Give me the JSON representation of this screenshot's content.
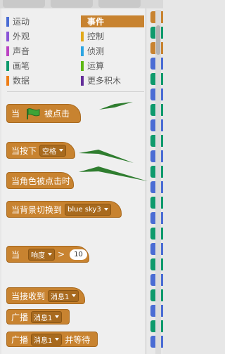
{
  "categories": [
    {
      "label": "运动",
      "color": "#4a6cd4",
      "selected": false
    },
    {
      "label": "事件",
      "color": "#c88330",
      "selected": true
    },
    {
      "label": "外观",
      "color": "#8a55d7",
      "selected": false
    },
    {
      "label": "控制",
      "color": "#e1a91a",
      "selected": false
    },
    {
      "label": "声音",
      "color": "#bb42c3",
      "selected": false
    },
    {
      "label": "侦测",
      "color": "#2ca5e2",
      "selected": false
    },
    {
      "label": "画笔",
      "color": "#0e9a6c",
      "selected": false
    },
    {
      "label": "运算",
      "color": "#5cb712",
      "selected": false
    },
    {
      "label": "数据",
      "color": "#ee7d16",
      "selected": false
    },
    {
      "label": "更多积木",
      "color": "#632d99",
      "selected": false
    }
  ],
  "blocks": {
    "when_flag": {
      "prefix": "当",
      "suffix": "被点击"
    },
    "when_key": {
      "prefix": "当按下",
      "key": "空格"
    },
    "when_sprite_clicked": {
      "label": "当角色被点击时"
    },
    "when_backdrop": {
      "prefix": "当背景切换到",
      "backdrop": "blue sky3"
    },
    "when_sensor": {
      "prefix": "当",
      "sensor": "响度",
      "op": ">",
      "value": "10"
    },
    "when_receive": {
      "prefix": "当接收到",
      "message": "消息1"
    },
    "broadcast": {
      "prefix": "广播",
      "message": "消息1"
    },
    "broadcast_wait": {
      "prefix": "广播",
      "message": "消息1",
      "suffix": "并等待"
    }
  },
  "colors": {
    "event_block": "#c88330",
    "arrow": "#2f7d2f",
    "flag": "#3fa336"
  },
  "icons": {
    "flag": "green-flag-icon"
  }
}
